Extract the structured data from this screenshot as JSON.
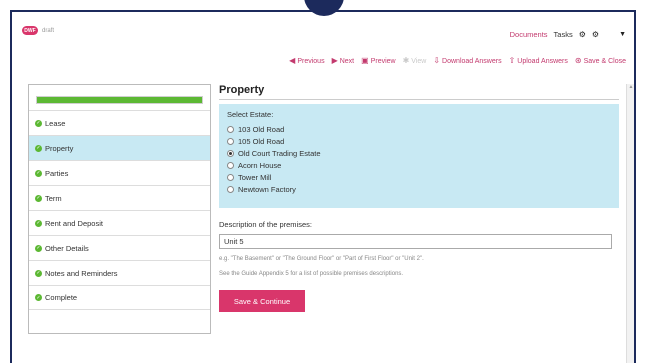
{
  "header": {
    "logo_badge": "DWF",
    "logo_text": "draft",
    "documents_label": "Documents",
    "tasks_label": "Tasks"
  },
  "toolbar": {
    "previous": "Previous",
    "next": "Next",
    "preview": "Preview",
    "view": "View",
    "download": "Download Answers",
    "upload": "Upload Answers",
    "save_close": "Save & Close"
  },
  "sidebar": {
    "progress_percent": 100,
    "items": [
      {
        "label": "Lease",
        "active": false
      },
      {
        "label": "Property",
        "active": true
      },
      {
        "label": "Parties",
        "active": false
      },
      {
        "label": "Term",
        "active": false
      },
      {
        "label": "Rent and Deposit",
        "active": false
      },
      {
        "label": "Other Details",
        "active": false
      },
      {
        "label": "Notes and Reminders",
        "active": false
      },
      {
        "label": "Complete",
        "active": false
      }
    ]
  },
  "main": {
    "title": "Property",
    "estate_label": "Select Estate:",
    "estates": [
      {
        "label": "103 Old Road",
        "selected": false
      },
      {
        "label": "105 Old Road",
        "selected": false
      },
      {
        "label": "Old Court Trading Estate",
        "selected": true
      },
      {
        "label": "Acorn House",
        "selected": false
      },
      {
        "label": "Tower Mill",
        "selected": false
      },
      {
        "label": "Newtown Factory",
        "selected": false
      }
    ],
    "desc_label": "Description of the premises:",
    "desc_value": "Unit 5",
    "hint": "e.g. \"The Basement\" or \"The Ground Floor\" or \"Part of First Floor\" or \"Unit 2\".",
    "guide": "See the Guide Appendix 5 for a list of possible premises descriptions.",
    "save_button": "Save & Continue"
  },
  "colors": {
    "accent": "#d9366b",
    "link": "#c33a6e",
    "active_bg": "#c8e9f3",
    "check": "#5cb833",
    "frame": "#1c2a5c"
  }
}
